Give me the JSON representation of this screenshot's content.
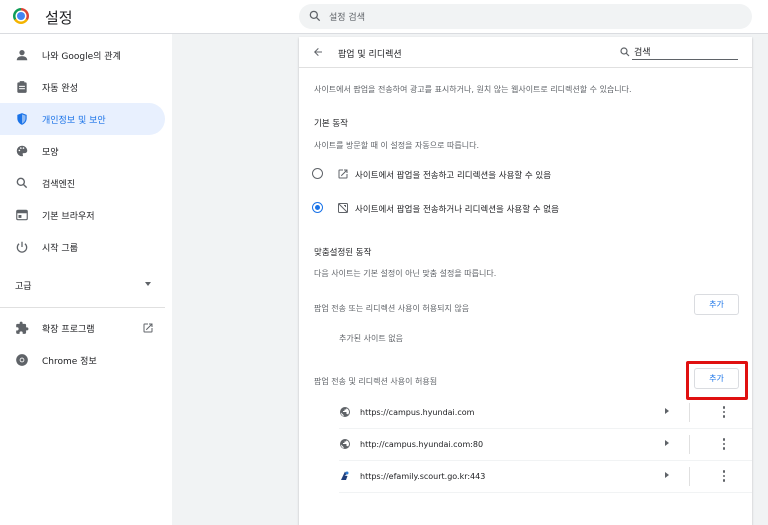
{
  "header": {
    "title": "설정",
    "search_placeholder": "설정 검색"
  },
  "sidebar": {
    "items": [
      {
        "label": "나와 Google의 관계",
        "icon": "person-icon"
      },
      {
        "label": "자동 완성",
        "icon": "clipboard-icon"
      },
      {
        "label": "개인정보 및 보안",
        "icon": "shield-icon",
        "active": true
      },
      {
        "label": "모양",
        "icon": "palette-icon"
      },
      {
        "label": "검색엔진",
        "icon": "search-icon"
      },
      {
        "label": "기본 브라우저",
        "icon": "browser-icon"
      },
      {
        "label": "시작 그룹",
        "icon": "power-icon"
      }
    ],
    "advanced_label": "고급",
    "extensions_label": "확장 프로그램",
    "about_label": "Chrome 정보"
  },
  "page": {
    "title": "팝업 및 리디렉션",
    "search_value": "검색",
    "description": "사이트에서 팝업을 전송하여 광고를 표시하거나, 원치 않는 웹사이트로 리디렉션할 수 있습니다.",
    "default_behavior_heading": "기본 동작",
    "default_behavior_desc": "사이트를 방문할 때 이 설정을 자동으로 따릅니다.",
    "option_allow": "사이트에서 팝업을 전송하고 리디렉션을 사용할 수 있음",
    "option_block": "사이트에서 팝업을 전송하거나 리디렉션을 사용할 수 없음",
    "selected_option": "block",
    "custom_heading": "맞춤설정된 동작",
    "custom_desc": "다음 사이트는 기본 설정이 아닌 맞춤 설정을 따릅니다.",
    "blocked_heading": "팝업 전송 또는 리디렉션 사용이 허용되지 않음",
    "blocked_empty": "추가된 사이트 없음",
    "allowed_heading": "팝업 전송 및 리디렉션 사용이 허용됨",
    "add_label": "추가",
    "allowed_sites": [
      {
        "url": "https://campus.hyundai.com",
        "icon": "globe-icon"
      },
      {
        "url": "http://campus.hyundai.com:80",
        "icon": "globe-icon"
      },
      {
        "url": "https://efamily.scourt.go.kr:443",
        "icon": "site-favicon-icon"
      }
    ]
  },
  "colors": {
    "accent": "#1a73e8",
    "highlight": "#e01010"
  }
}
